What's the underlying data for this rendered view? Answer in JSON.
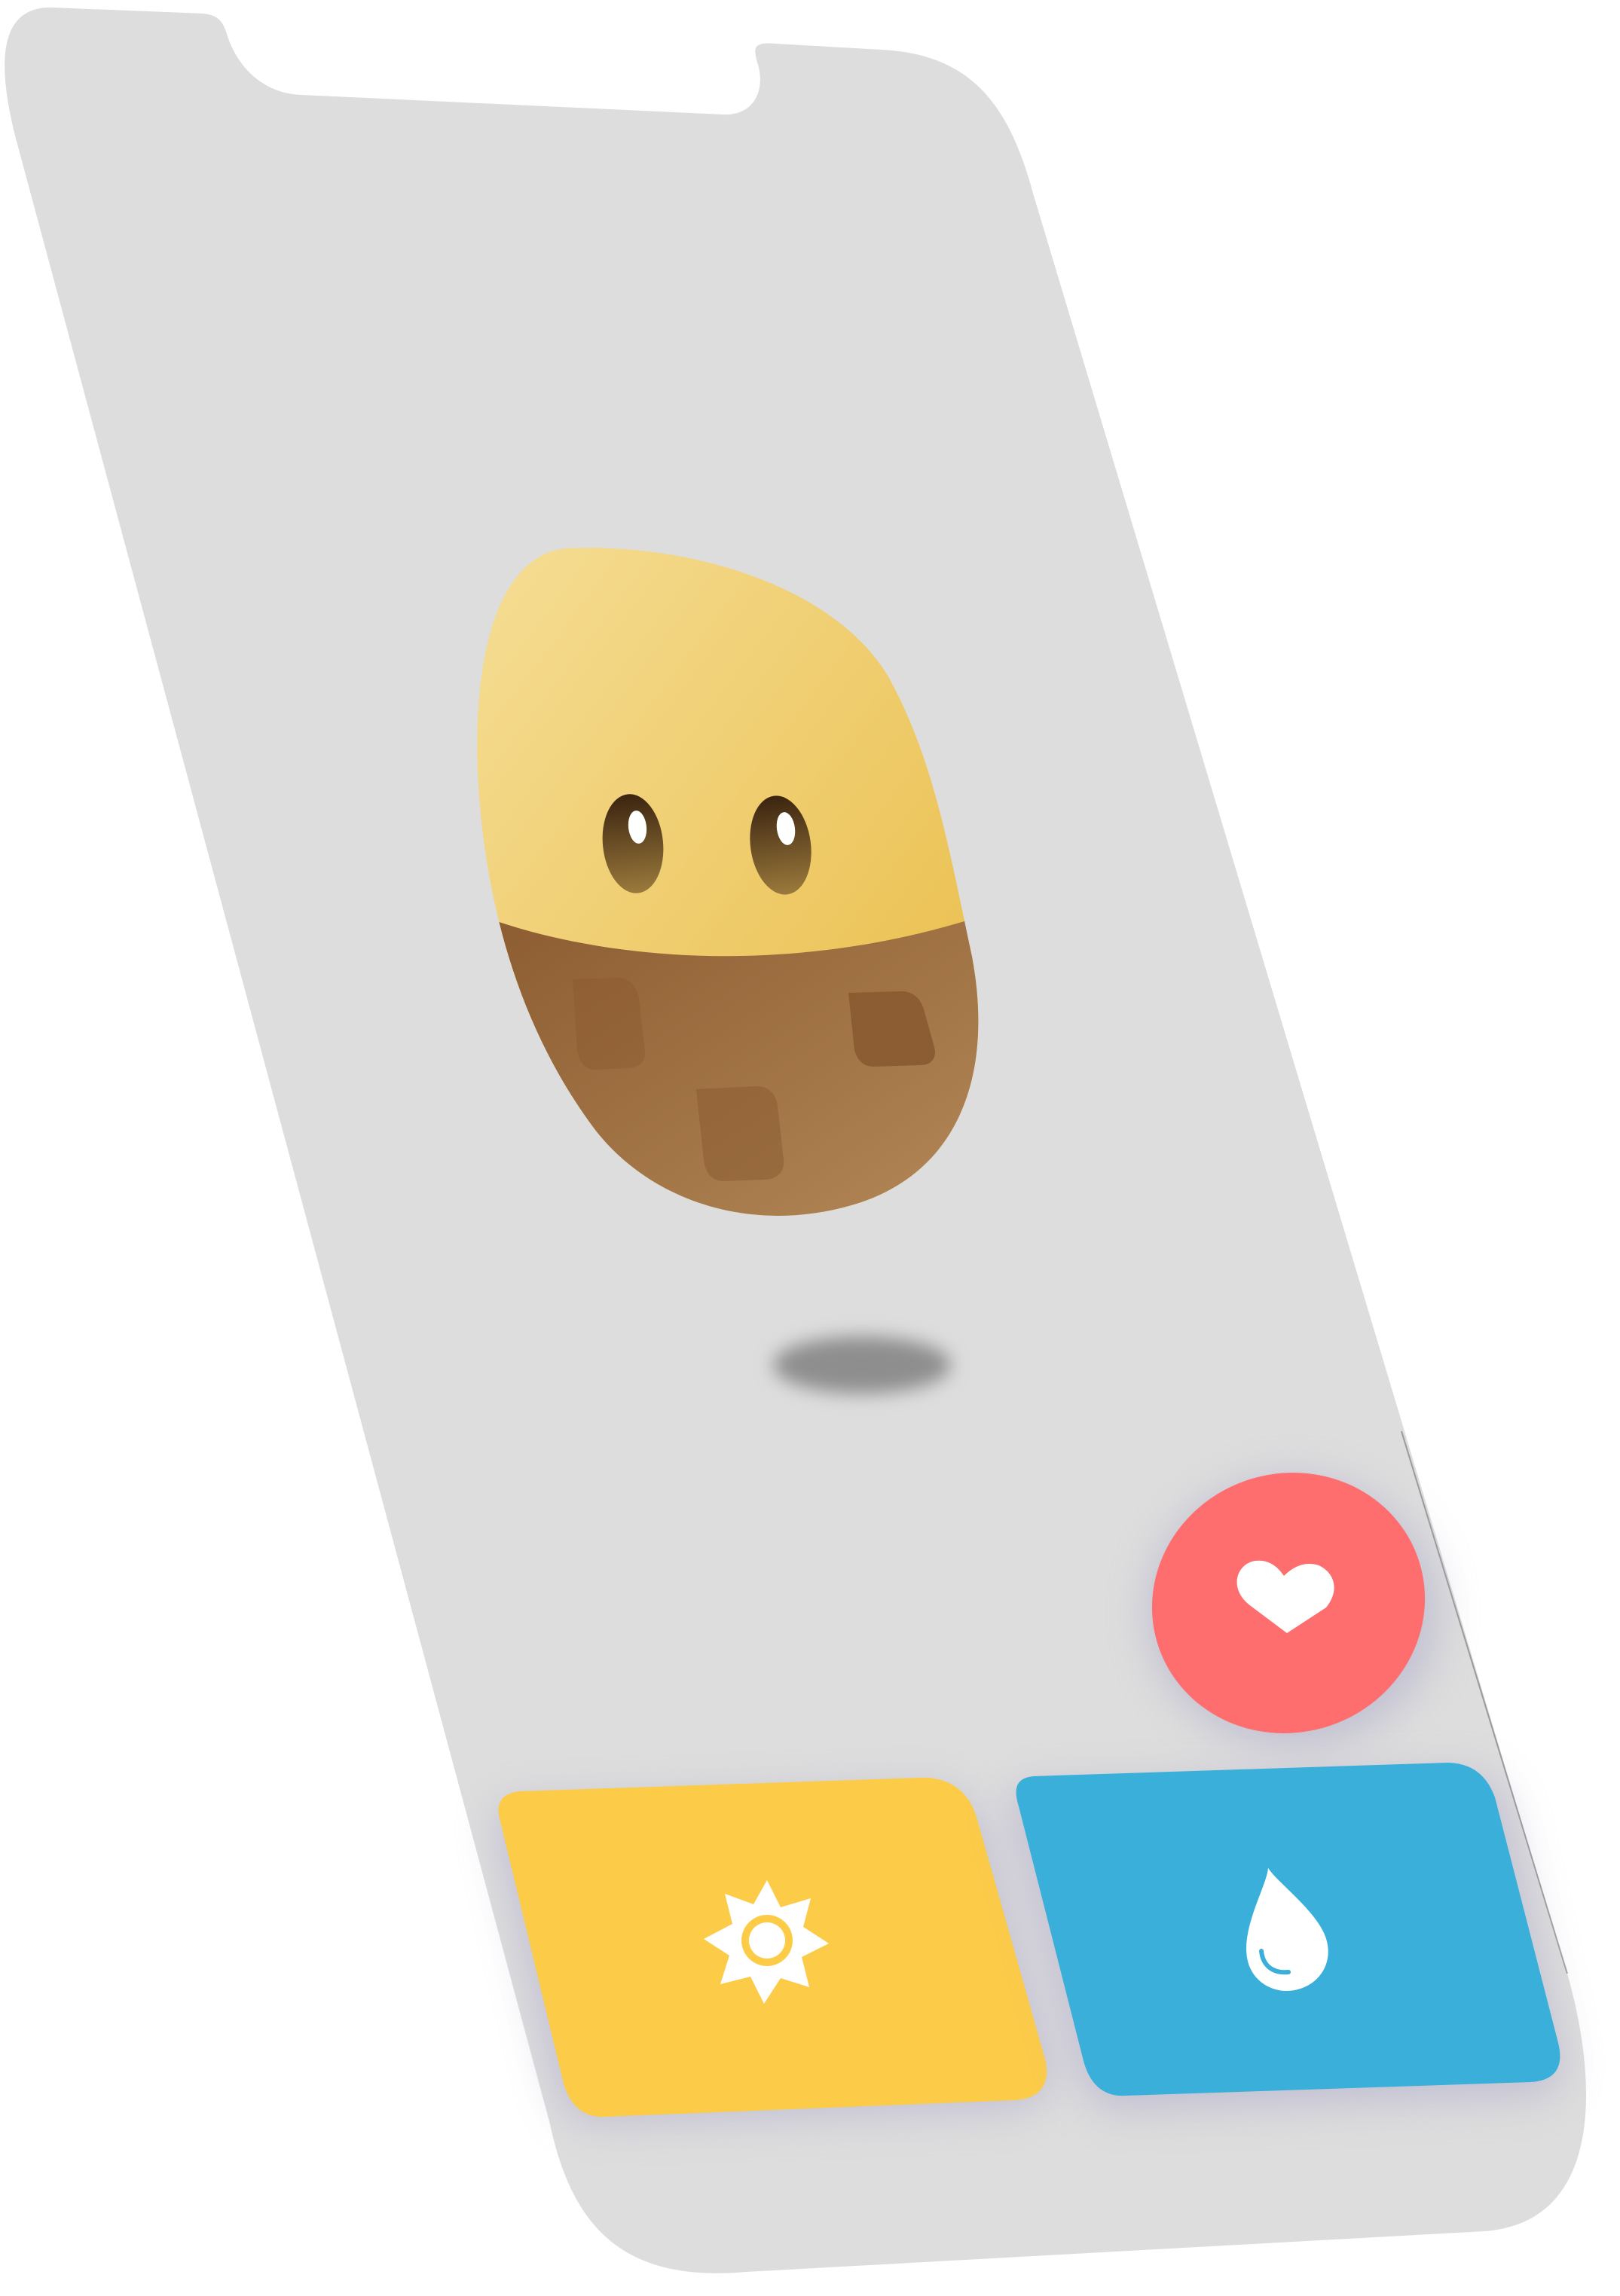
{
  "app": {
    "device_frame": "phone-screen-tilted",
    "background_color": "#dddddd"
  },
  "pet": {
    "character": "potato",
    "top_color": "#f2cf6f",
    "bottom_color": "#9b6c3e",
    "eye_color": "#5a3a16",
    "shadow_color": "#8e8e8e"
  },
  "actions": {
    "love": {
      "icon": "heart-icon",
      "color": "#ff6e6e"
    },
    "sun": {
      "icon": "sun-icon",
      "color": "#fccb48"
    },
    "water": {
      "icon": "water-drop-icon",
      "color": "#3aafda"
    }
  }
}
